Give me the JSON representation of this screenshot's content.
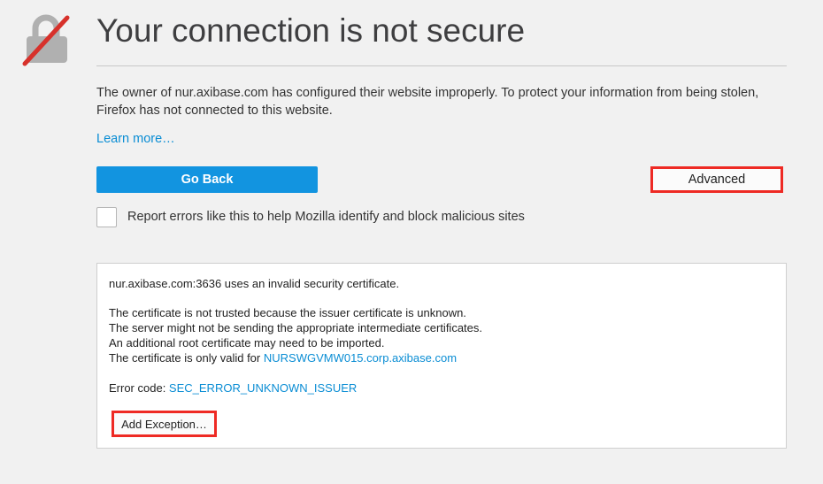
{
  "header": {
    "title": "Your connection is not secure",
    "icon": "broken-lock-icon"
  },
  "intro": {
    "text": "The owner of nur.axibase.com has configured their website improperly. To protect your information from being stolen, Firefox has not connected to this website.",
    "learn_more": "Learn more…"
  },
  "actions": {
    "go_back": "Go Back",
    "advanced": "Advanced"
  },
  "report": {
    "checked": false,
    "label": "Report errors like this to help Mozilla identify and block malicious sites"
  },
  "details": {
    "summary": "nur.axibase.com:3636 uses an invalid security certificate.",
    "lines": [
      "The certificate is not trusted because the issuer certificate is unknown.",
      "The server might not be sending the appropriate intermediate certificates.",
      "An additional root certificate may need to be imported."
    ],
    "valid_for_prefix": "The certificate is only valid for ",
    "valid_for_host": "NURSWGVMW015.corp.axibase.com",
    "error_code_prefix": "Error code: ",
    "error_code": "SEC_ERROR_UNKNOWN_ISSUER",
    "add_exception": "Add Exception…"
  },
  "colors": {
    "background": "#f1f1f1",
    "primary_button": "#1294e0",
    "link": "#0a8dd4",
    "highlight_border": "#ee2a24"
  }
}
